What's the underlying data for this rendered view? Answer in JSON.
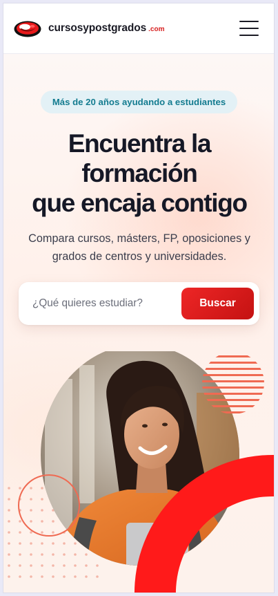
{
  "header": {
    "logo": {
      "name": "cursosypostgrados",
      "tld": ".com",
      "icon": "logo-mark-icon"
    },
    "menu": {
      "icon": "hamburger-menu-icon"
    }
  },
  "hero": {
    "badge": "Más de 20 años ayudando a estudiantes",
    "title_lines": [
      "Encuentra la",
      "formación",
      "que encaja contigo"
    ],
    "subtitle_lines": [
      "Compara cursos, másters, FP, oposiciones y",
      "grados de centros y universidades."
    ],
    "search": {
      "placeholder": "¿Qué quieres estudiar?",
      "button_label": "Buscar"
    },
    "image": {
      "subject": "smiling-student-photo"
    }
  },
  "colors": {
    "brand_red": "#e8191b",
    "badge_bg": "#e3f1f6",
    "badge_text": "#147c90",
    "title": "#151826",
    "accent_coral": "#ef6a52"
  }
}
